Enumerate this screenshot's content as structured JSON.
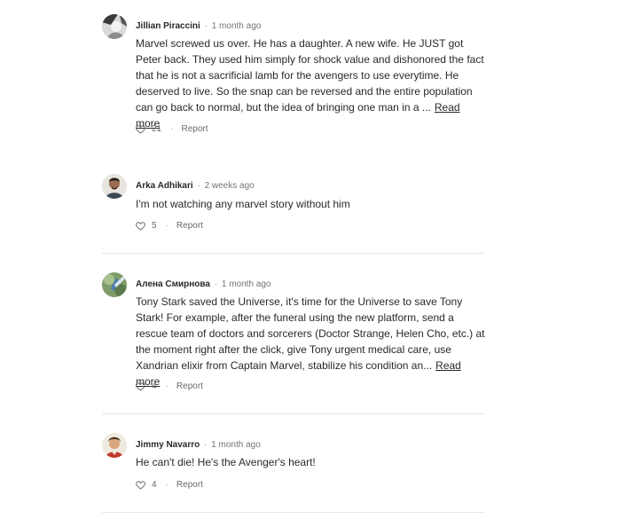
{
  "comments": [
    {
      "author": "Jillian Piraccini",
      "time": "1 month ago",
      "body": "Marvel screwed us over. He has a daughter. A new wife. He JUST got Peter back. They used him simply for shock value and dishonored the fact that he is not a sacrificial lamb for the avengers to use everytime. He deserved to live. So the snap can be reversed and the entire population can go back to normal, but the idea of bringing one man in a ...",
      "read_more": "Read more",
      "likes": "21",
      "report": "Report",
      "avatar_icon": "user-avatar-photo"
    },
    {
      "author": "Arka Adhikari",
      "time": "2 weeks ago",
      "body": "I'm not watching any marvel story without him",
      "read_more": "",
      "likes": "5",
      "report": "Report",
      "avatar_icon": "user-avatar-photo"
    },
    {
      "author": "Алена Смирнова",
      "time": "1 month ago",
      "body": "Tony Stark saved the Universe, it's time for the Universe to save Tony Stark! For example, after the funeral using the new platform, send a rescue team of doctors and sorcerers (Doctor Strange, Helen Cho, etc.) at the moment right after the click, give Tony urgent medical care, use Xandrian elixir from Captain Marvel, stabilize his condition an...",
      "read_more": "Read more",
      "likes": "4",
      "report": "Report",
      "avatar_icon": "user-avatar-photo"
    },
    {
      "author": "Jimmy Navarro",
      "time": "1 month ago",
      "body": "He can't die! He's the Avenger's heart!",
      "read_more": "",
      "likes": "4",
      "report": "Report",
      "avatar_icon": "user-avatar-photo"
    }
  ],
  "separator": "·",
  "colors": {
    "text": "#292929",
    "muted": "#757575",
    "divider": "#e6e6e6"
  },
  "icons": {
    "like": "heart-outline-icon"
  }
}
